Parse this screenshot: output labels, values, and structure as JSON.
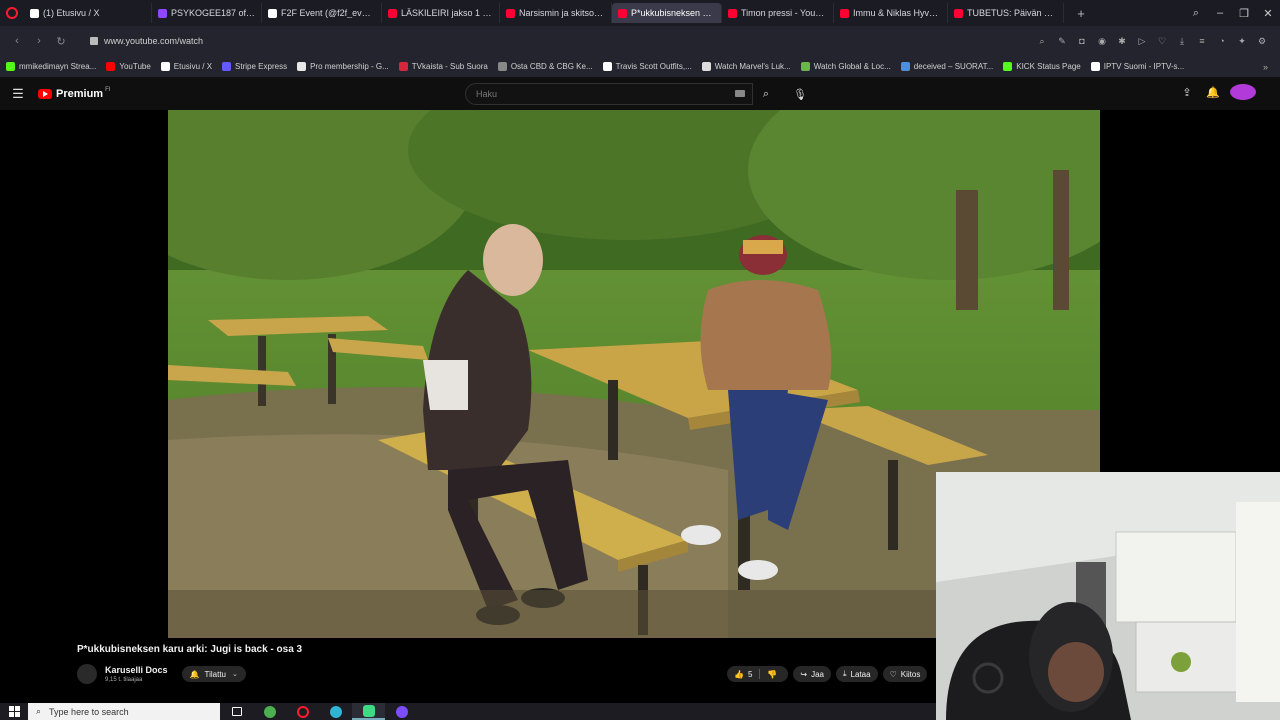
{
  "browser": {
    "tabs": [
      {
        "label": "(1) Etusivu / X",
        "favicon_color": "#ffffff"
      },
      {
        "label": "PSYKOGEE187 official (@",
        "favicon_color": "#9146ff"
      },
      {
        "label": "F2F Event (@f2f_event) |",
        "favicon_color": "#ffffff"
      },
      {
        "label": "LÄSKILEIRI jakso 1 Feat Te",
        "favicon_color": "#ff0033"
      },
      {
        "label": "Narsismin ja skitsoidisuu",
        "favicon_color": "#ff0033"
      },
      {
        "label": "P*ukkubisneksen kar",
        "favicon_color": "#ff0033",
        "active": true
      },
      {
        "label": "Timon pressi - YouTube",
        "favicon_color": "#ff0033"
      },
      {
        "label": "Immu & Niklas Hyväriner",
        "favicon_color": "#ff0033"
      },
      {
        "label": "TUBETUS: Päivän parhaat",
        "favicon_color": "#ff0033"
      }
    ],
    "url": "www.youtube.com/watch",
    "bookmarks": [
      {
        "label": "mmikedimayn Strea...",
        "favicon_color": "#53fc18"
      },
      {
        "label": "YouTube",
        "favicon_color": "#ff0000"
      },
      {
        "label": "Etusivu / X",
        "favicon_color": "#ffffff"
      },
      {
        "label": "Stripe Express",
        "favicon_color": "#635bff"
      },
      {
        "label": "Pro membership - G...",
        "favicon_color": "#e8e8e8"
      },
      {
        "label": "TVkaista - Sub Suora",
        "favicon_color": "#d6263b"
      },
      {
        "label": "Osta CBD & CBG Ke...",
        "favicon_color": "#888888"
      },
      {
        "label": "Travis Scott Outfits,...",
        "favicon_color": "#ffffff"
      },
      {
        "label": "Watch Marvel's Luk...",
        "favicon_color": "#dddddd"
      },
      {
        "label": "Watch Global & Loc...",
        "favicon_color": "#6bb64a"
      },
      {
        "label": "deceived – SUORAT...",
        "favicon_color": "#4a90e2"
      },
      {
        "label": "KICK Status Page",
        "favicon_color": "#53fc18"
      },
      {
        "label": "IPTV Suomi - IPTV-s...",
        "favicon_color": "#ffffff"
      }
    ]
  },
  "youtube": {
    "logo_text": "Premium",
    "region": "FI",
    "search_placeholder": "Haku",
    "video_title": "P*ukkubisneksen karu arki: Jugi is back - osa 3",
    "channel_name": "Karuselli Docs",
    "subscribers": "9,15 t. tilaajaa",
    "subscribe_label": "Tilattu",
    "like_count": "5",
    "share_label": "Jaa",
    "download_label": "Lataa",
    "thanks_label": "Kiitos"
  },
  "taskbar": {
    "search_placeholder": "Type here to search",
    "apps": [
      {
        "name": "task-view",
        "color": "#ffffff"
      },
      {
        "name": "chrome",
        "color": "#4caf50"
      },
      {
        "name": "opera",
        "color": "#ff1b2d"
      },
      {
        "name": "edge",
        "color": "#2fb5d6"
      },
      {
        "name": "opera-gx",
        "color": "#3ddc84"
      },
      {
        "name": "discord",
        "color": "#7c4dff"
      }
    ]
  }
}
